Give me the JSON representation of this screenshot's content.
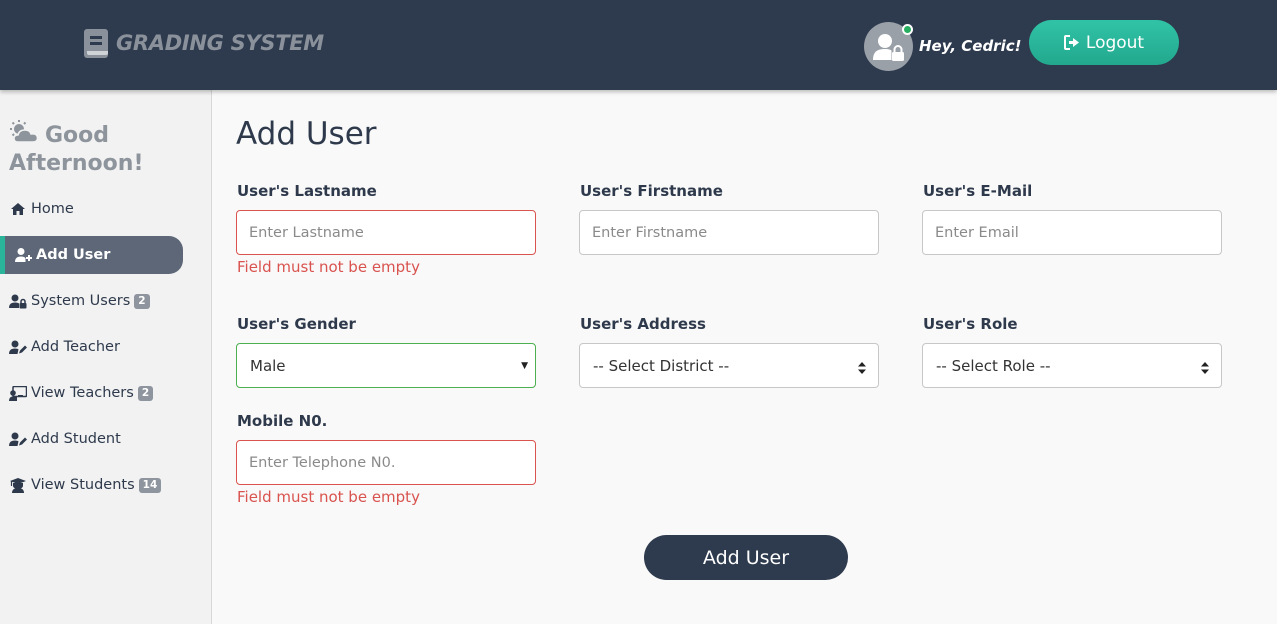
{
  "header": {
    "brand_part1": "GRADING",
    "brand_part2": "SYSTEM",
    "greeting": "Hey, Cedric!",
    "logout_label": "Logout"
  },
  "sidebar": {
    "greeting": "Good Afternoon!",
    "items": [
      {
        "label": "Home",
        "icon": "home-icon"
      },
      {
        "label": "Add User",
        "icon": "add-user-icon",
        "active": true
      },
      {
        "label": "System Users",
        "icon": "users-lock-icon",
        "badge": "2"
      },
      {
        "label": "Add Teacher",
        "icon": "user-edit-icon"
      },
      {
        "label": "View Teachers",
        "icon": "chalkboard-teacher-icon",
        "badge": "2"
      },
      {
        "label": "Add Student",
        "icon": "user-edit-icon"
      },
      {
        "label": "View Students",
        "icon": "graduate-icon",
        "badge": "14"
      }
    ]
  },
  "main": {
    "title": "Add User",
    "fields": {
      "lastname": {
        "label": "User's Lastname",
        "placeholder": "Enter Lastname",
        "value": "",
        "error": "Field must not be empty"
      },
      "firstname": {
        "label": "User's Firstname",
        "placeholder": "Enter Firstname",
        "value": ""
      },
      "email": {
        "label": "User's E-Mail",
        "placeholder": "Enter Email",
        "value": ""
      },
      "gender": {
        "label": "User's Gender",
        "selected": "Male"
      },
      "address": {
        "label": "User's Address",
        "selected": "-- Select District --"
      },
      "role": {
        "label": "User's Role",
        "selected": "-- Select Role --"
      },
      "mobile": {
        "label": "Mobile N0.",
        "placeholder": "Enter Telephone N0.",
        "value": "",
        "error": "Field must not be empty"
      }
    },
    "submit_label": "Add User"
  },
  "colors": {
    "header_bg": "#2e3a4e",
    "accent": "#2ab499",
    "error": "#d9534f",
    "valid": "#4caf50"
  }
}
